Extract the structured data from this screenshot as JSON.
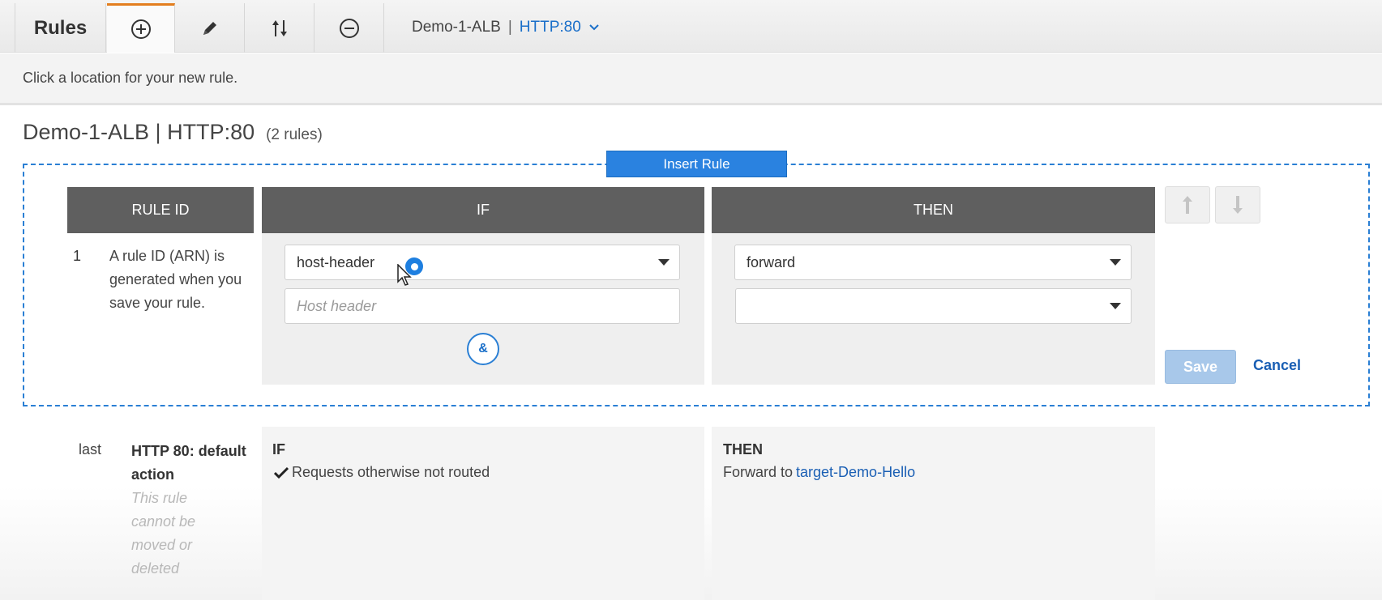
{
  "toolbar": {
    "title": "Rules",
    "add_icon": "plus-circle-icon",
    "edit_icon": "pencil-icon",
    "reorder_icon": "up-down-arrows-icon",
    "remove_icon": "minus-circle-icon",
    "load_balancer": "Demo-1-ALB",
    "separator": "|",
    "listener": "HTTP:80"
  },
  "instruction": "Click a location for your new rule.",
  "section": {
    "name": "Demo-1-ALB | HTTP:80",
    "count": "(2 rules)"
  },
  "insert_rule_label": "Insert Rule",
  "columns": {
    "rule_id": "RULE ID",
    "if": "IF",
    "then": "THEN"
  },
  "new_rule": {
    "number": "1",
    "description": "A rule ID (ARN) is generated when you save your rule.",
    "condition_type": "host-header",
    "host_placeholder": "Host header",
    "and_label": "&",
    "action_type": "forward",
    "target_value": "",
    "save_label": "Save",
    "cancel_label": "Cancel"
  },
  "default_rule": {
    "number": "last",
    "title": "HTTP 80: default action",
    "note": "This rule cannot be moved or deleted",
    "if_label": "IF",
    "condition": "Requests otherwise not routed",
    "then_label": "THEN",
    "action_prefix": "Forward to",
    "target": "target-Demo-Hello"
  },
  "colors": {
    "accent": "#2a82e0",
    "tab_active": "#e37e1e",
    "header_bg": "#5f5f5f",
    "link": "#1a5fb4"
  }
}
